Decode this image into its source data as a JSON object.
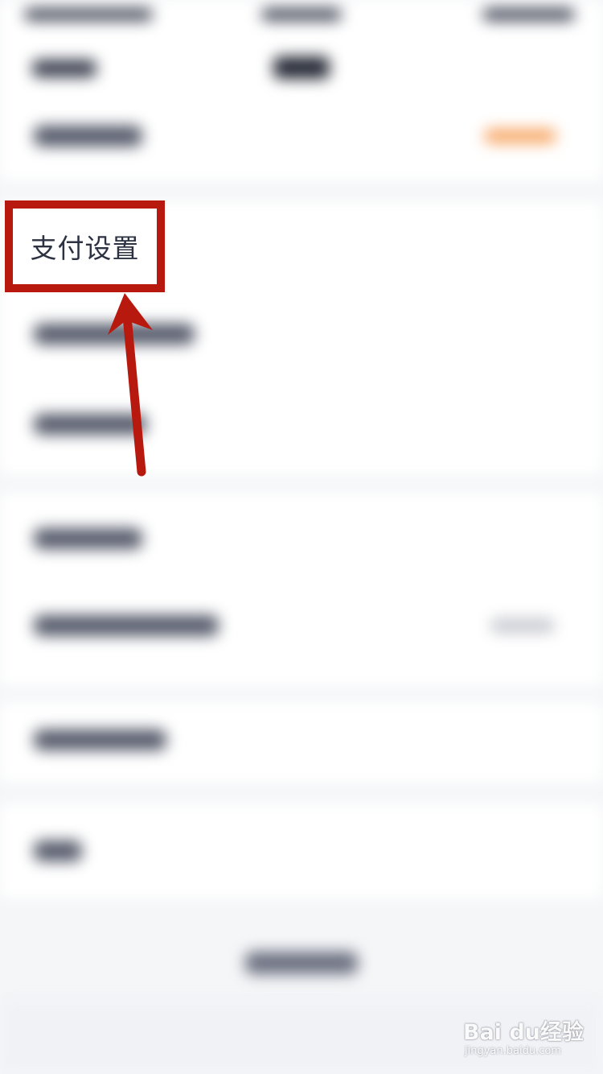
{
  "highlight": {
    "label": "支付设置",
    "box_color": "#b8190f",
    "arrow_color": "#b8190f"
  },
  "watermark": {
    "logo_text": "Bai du经验",
    "url_text": "jingyan.baidu.com"
  },
  "colors": {
    "background": "#f5f6f8",
    "section_bg": "#ffffff",
    "text_dark": "#2c3242",
    "accent_orange": "#f7a766"
  }
}
